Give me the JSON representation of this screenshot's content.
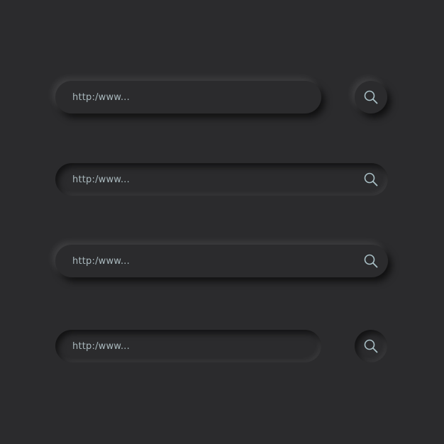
{
  "colors": {
    "background": "#2b2b2d",
    "text": "#a9b8bd",
    "icon": "#a9c0c6"
  },
  "icon": "search-icon",
  "search_bars": [
    {
      "url_text": "http:/www..."
    },
    {
      "url_text": "http:/www..."
    },
    {
      "url_text": "http:/www..."
    },
    {
      "url_text": "http:/www..."
    }
  ]
}
